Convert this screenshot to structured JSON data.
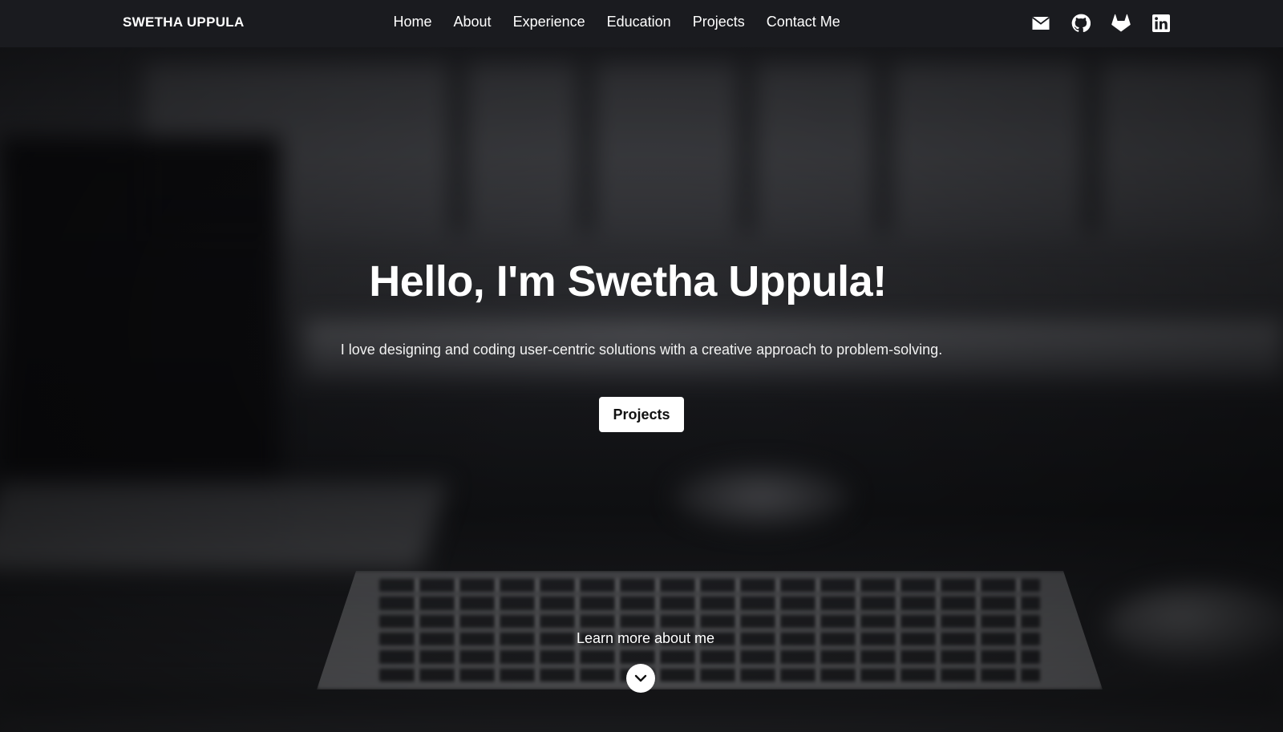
{
  "navbar": {
    "brand": "SWETHA UPPULA",
    "links": [
      {
        "label": "Home"
      },
      {
        "label": "About"
      },
      {
        "label": "Experience"
      },
      {
        "label": "Education"
      },
      {
        "label": "Projects"
      },
      {
        "label": "Contact Me"
      }
    ],
    "social_icons": [
      "envelope-icon",
      "github-icon",
      "gitlab-icon",
      "linkedin-icon"
    ]
  },
  "hero": {
    "title": "Hello, I'm Swetha Uppula!",
    "subtitle": "I love designing and coding user-centric solutions with a creative approach to problem-solving.",
    "cta_label": "Projects",
    "learn_more": "Learn more about me",
    "scroll_icon": "chevron-down-icon"
  },
  "colors": {
    "navbar_bg": "#1a1b1f",
    "text": "#ffffff",
    "button_bg": "#ffffff",
    "button_text": "#111111"
  }
}
